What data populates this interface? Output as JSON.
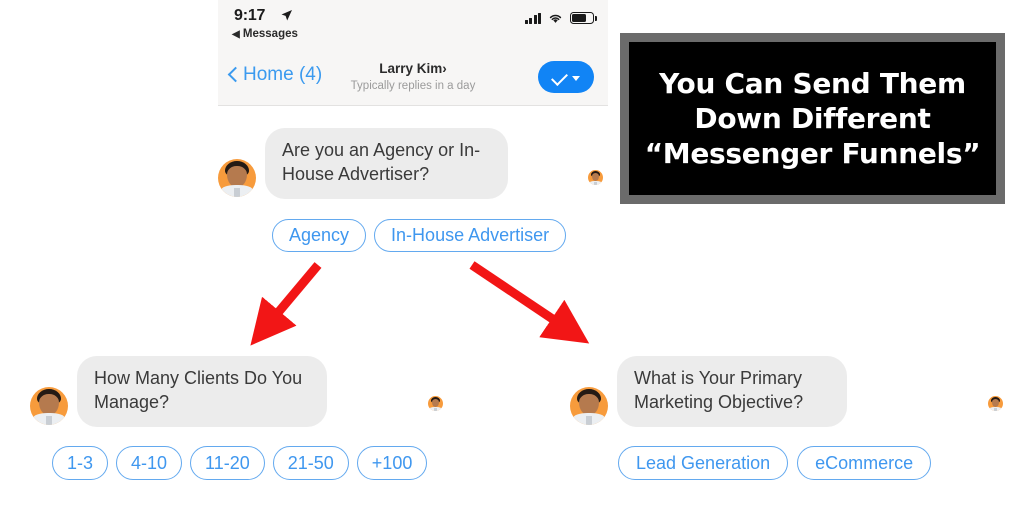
{
  "phone": {
    "status_bar": {
      "time": "9:17",
      "location_icon": "location-arrow-icon",
      "back_app_label": "Messages",
      "back_triangle": "◀",
      "signal_icon": "cellular-signal-icon",
      "wifi_icon": "wifi-icon",
      "battery_icon": "battery-icon"
    },
    "nav_bar": {
      "back_label": "Home (4)",
      "title": "Larry Kim",
      "title_chevron": "›",
      "subtitle": "Typically replies in a day",
      "action_icon": "checkmark-dropdown-button"
    }
  },
  "conversation": {
    "root": {
      "message": "Are you an Agency or In-House Advertiser?",
      "quick_replies": [
        "Agency",
        "In-House Advertiser"
      ]
    },
    "left_branch": {
      "message": "How Many Clients Do You Manage?",
      "quick_replies": [
        "1-3",
        "4-10",
        "11-20",
        "21-50",
        "+100"
      ]
    },
    "right_branch": {
      "message": "What is Your Primary Marketing Objective?",
      "quick_replies": [
        "Lead Generation",
        "eCommerce"
      ]
    }
  },
  "caption": {
    "lines": [
      "You Can Send Them",
      "Down Different",
      "“Messenger Funnels”"
    ]
  },
  "annotations": {
    "arrow_left_name": "red-arrow-to-left-branch",
    "arrow_right_name": "red-arrow-to-right-branch",
    "arrow_color": "#f21616"
  },
  "colors": {
    "accent_blue": "#3f97ef",
    "chip_border": "#63a9ef",
    "bubble_gray": "#ececec",
    "avatar_orange": "#f79b3c",
    "caption_border": "#6b6b6b"
  }
}
